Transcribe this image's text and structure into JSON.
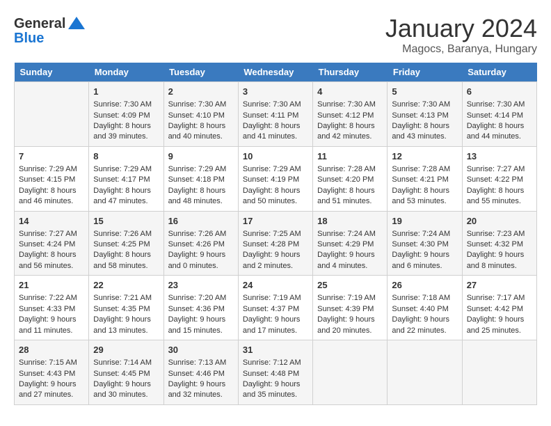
{
  "header": {
    "logo_line1": "General",
    "logo_line2": "Blue",
    "month": "January 2024",
    "location": "Magocs, Baranya, Hungary"
  },
  "weekdays": [
    "Sunday",
    "Monday",
    "Tuesday",
    "Wednesday",
    "Thursday",
    "Friday",
    "Saturday"
  ],
  "weeks": [
    [
      {
        "day": "",
        "sunrise": "",
        "sunset": "",
        "daylight": ""
      },
      {
        "day": "1",
        "sunrise": "Sunrise: 7:30 AM",
        "sunset": "Sunset: 4:09 PM",
        "daylight": "Daylight: 8 hours and 39 minutes."
      },
      {
        "day": "2",
        "sunrise": "Sunrise: 7:30 AM",
        "sunset": "Sunset: 4:10 PM",
        "daylight": "Daylight: 8 hours and 40 minutes."
      },
      {
        "day": "3",
        "sunrise": "Sunrise: 7:30 AM",
        "sunset": "Sunset: 4:11 PM",
        "daylight": "Daylight: 8 hours and 41 minutes."
      },
      {
        "day": "4",
        "sunrise": "Sunrise: 7:30 AM",
        "sunset": "Sunset: 4:12 PM",
        "daylight": "Daylight: 8 hours and 42 minutes."
      },
      {
        "day": "5",
        "sunrise": "Sunrise: 7:30 AM",
        "sunset": "Sunset: 4:13 PM",
        "daylight": "Daylight: 8 hours and 43 minutes."
      },
      {
        "day": "6",
        "sunrise": "Sunrise: 7:30 AM",
        "sunset": "Sunset: 4:14 PM",
        "daylight": "Daylight: 8 hours and 44 minutes."
      }
    ],
    [
      {
        "day": "7",
        "sunrise": "Sunrise: 7:29 AM",
        "sunset": "Sunset: 4:15 PM",
        "daylight": "Daylight: 8 hours and 46 minutes."
      },
      {
        "day": "8",
        "sunrise": "Sunrise: 7:29 AM",
        "sunset": "Sunset: 4:17 PM",
        "daylight": "Daylight: 8 hours and 47 minutes."
      },
      {
        "day": "9",
        "sunrise": "Sunrise: 7:29 AM",
        "sunset": "Sunset: 4:18 PM",
        "daylight": "Daylight: 8 hours and 48 minutes."
      },
      {
        "day": "10",
        "sunrise": "Sunrise: 7:29 AM",
        "sunset": "Sunset: 4:19 PM",
        "daylight": "Daylight: 8 hours and 50 minutes."
      },
      {
        "day": "11",
        "sunrise": "Sunrise: 7:28 AM",
        "sunset": "Sunset: 4:20 PM",
        "daylight": "Daylight: 8 hours and 51 minutes."
      },
      {
        "day": "12",
        "sunrise": "Sunrise: 7:28 AM",
        "sunset": "Sunset: 4:21 PM",
        "daylight": "Daylight: 8 hours and 53 minutes."
      },
      {
        "day": "13",
        "sunrise": "Sunrise: 7:27 AM",
        "sunset": "Sunset: 4:22 PM",
        "daylight": "Daylight: 8 hours and 55 minutes."
      }
    ],
    [
      {
        "day": "14",
        "sunrise": "Sunrise: 7:27 AM",
        "sunset": "Sunset: 4:24 PM",
        "daylight": "Daylight: 8 hours and 56 minutes."
      },
      {
        "day": "15",
        "sunrise": "Sunrise: 7:26 AM",
        "sunset": "Sunset: 4:25 PM",
        "daylight": "Daylight: 8 hours and 58 minutes."
      },
      {
        "day": "16",
        "sunrise": "Sunrise: 7:26 AM",
        "sunset": "Sunset: 4:26 PM",
        "daylight": "Daylight: 9 hours and 0 minutes."
      },
      {
        "day": "17",
        "sunrise": "Sunrise: 7:25 AM",
        "sunset": "Sunset: 4:28 PM",
        "daylight": "Daylight: 9 hours and 2 minutes."
      },
      {
        "day": "18",
        "sunrise": "Sunrise: 7:24 AM",
        "sunset": "Sunset: 4:29 PM",
        "daylight": "Daylight: 9 hours and 4 minutes."
      },
      {
        "day": "19",
        "sunrise": "Sunrise: 7:24 AM",
        "sunset": "Sunset: 4:30 PM",
        "daylight": "Daylight: 9 hours and 6 minutes."
      },
      {
        "day": "20",
        "sunrise": "Sunrise: 7:23 AM",
        "sunset": "Sunset: 4:32 PM",
        "daylight": "Daylight: 9 hours and 8 minutes."
      }
    ],
    [
      {
        "day": "21",
        "sunrise": "Sunrise: 7:22 AM",
        "sunset": "Sunset: 4:33 PM",
        "daylight": "Daylight: 9 hours and 11 minutes."
      },
      {
        "day": "22",
        "sunrise": "Sunrise: 7:21 AM",
        "sunset": "Sunset: 4:35 PM",
        "daylight": "Daylight: 9 hours and 13 minutes."
      },
      {
        "day": "23",
        "sunrise": "Sunrise: 7:20 AM",
        "sunset": "Sunset: 4:36 PM",
        "daylight": "Daylight: 9 hours and 15 minutes."
      },
      {
        "day": "24",
        "sunrise": "Sunrise: 7:19 AM",
        "sunset": "Sunset: 4:37 PM",
        "daylight": "Daylight: 9 hours and 17 minutes."
      },
      {
        "day": "25",
        "sunrise": "Sunrise: 7:19 AM",
        "sunset": "Sunset: 4:39 PM",
        "daylight": "Daylight: 9 hours and 20 minutes."
      },
      {
        "day": "26",
        "sunrise": "Sunrise: 7:18 AM",
        "sunset": "Sunset: 4:40 PM",
        "daylight": "Daylight: 9 hours and 22 minutes."
      },
      {
        "day": "27",
        "sunrise": "Sunrise: 7:17 AM",
        "sunset": "Sunset: 4:42 PM",
        "daylight": "Daylight: 9 hours and 25 minutes."
      }
    ],
    [
      {
        "day": "28",
        "sunrise": "Sunrise: 7:15 AM",
        "sunset": "Sunset: 4:43 PM",
        "daylight": "Daylight: 9 hours and 27 minutes."
      },
      {
        "day": "29",
        "sunrise": "Sunrise: 7:14 AM",
        "sunset": "Sunset: 4:45 PM",
        "daylight": "Daylight: 9 hours and 30 minutes."
      },
      {
        "day": "30",
        "sunrise": "Sunrise: 7:13 AM",
        "sunset": "Sunset: 4:46 PM",
        "daylight": "Daylight: 9 hours and 32 minutes."
      },
      {
        "day": "31",
        "sunrise": "Sunrise: 7:12 AM",
        "sunset": "Sunset: 4:48 PM",
        "daylight": "Daylight: 9 hours and 35 minutes."
      },
      {
        "day": "",
        "sunrise": "",
        "sunset": "",
        "daylight": ""
      },
      {
        "day": "",
        "sunrise": "",
        "sunset": "",
        "daylight": ""
      },
      {
        "day": "",
        "sunrise": "",
        "sunset": "",
        "daylight": ""
      }
    ]
  ]
}
